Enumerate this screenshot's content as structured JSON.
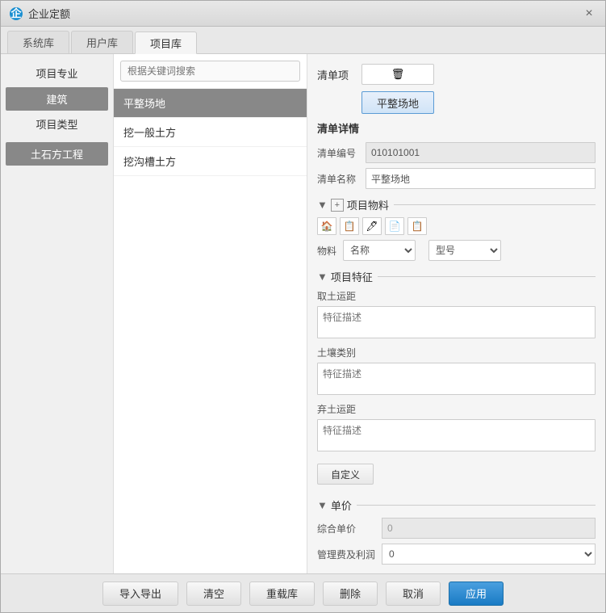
{
  "titlebar": {
    "title": "企业定额",
    "close_label": "×"
  },
  "tabs": [
    {
      "label": "系统库",
      "active": false
    },
    {
      "label": "用户库",
      "active": false
    },
    {
      "label": "项目库",
      "active": true
    }
  ],
  "sidebar": {
    "project_pro_label": "项目专业",
    "category1": "建筑",
    "project_type_label": "项目类型",
    "category2": "土石方工程"
  },
  "search": {
    "placeholder": "根据关键词搜索"
  },
  "list_items": [
    {
      "label": "平整场地",
      "selected": true
    },
    {
      "label": "挖一般土方",
      "selected": false
    },
    {
      "label": "挖沟槽土方",
      "selected": false
    }
  ],
  "qingdan": {
    "label": "清单项",
    "trash_icon": "🗑",
    "item_name": "平整场地"
  },
  "detail": {
    "section_label": "清单详情",
    "bianhao_label": "清单编号",
    "bianhao_value": "010101001",
    "mingcheng_label": "清单名称",
    "mingcheng_value": "平整场地"
  },
  "project_material": {
    "section_label": "项目物料",
    "icons": [
      "🏠",
      "📋",
      "🖊",
      "📄",
      "📋"
    ],
    "material_label": "物料",
    "name_label": "名称",
    "model_label": "型号"
  },
  "project_char": {
    "section_label": "项目特征",
    "char1_label": "取土运距",
    "char2_label": "土壤类别",
    "char3_label": "弃土运距",
    "placeholder": "特征描述",
    "custom_btn_label": "自定义"
  },
  "unit_price": {
    "section_label": "单价",
    "zhonghe_label": "综合单价",
    "zhonghe_value": "0",
    "guanli_label": "管理费及利润",
    "guanli_value": "0"
  },
  "toolbar": {
    "import_label": "导入导出",
    "clear_label": "清空",
    "reload_label": "重载库",
    "delete_label": "删除",
    "cancel_label": "取消",
    "apply_label": "应用"
  }
}
